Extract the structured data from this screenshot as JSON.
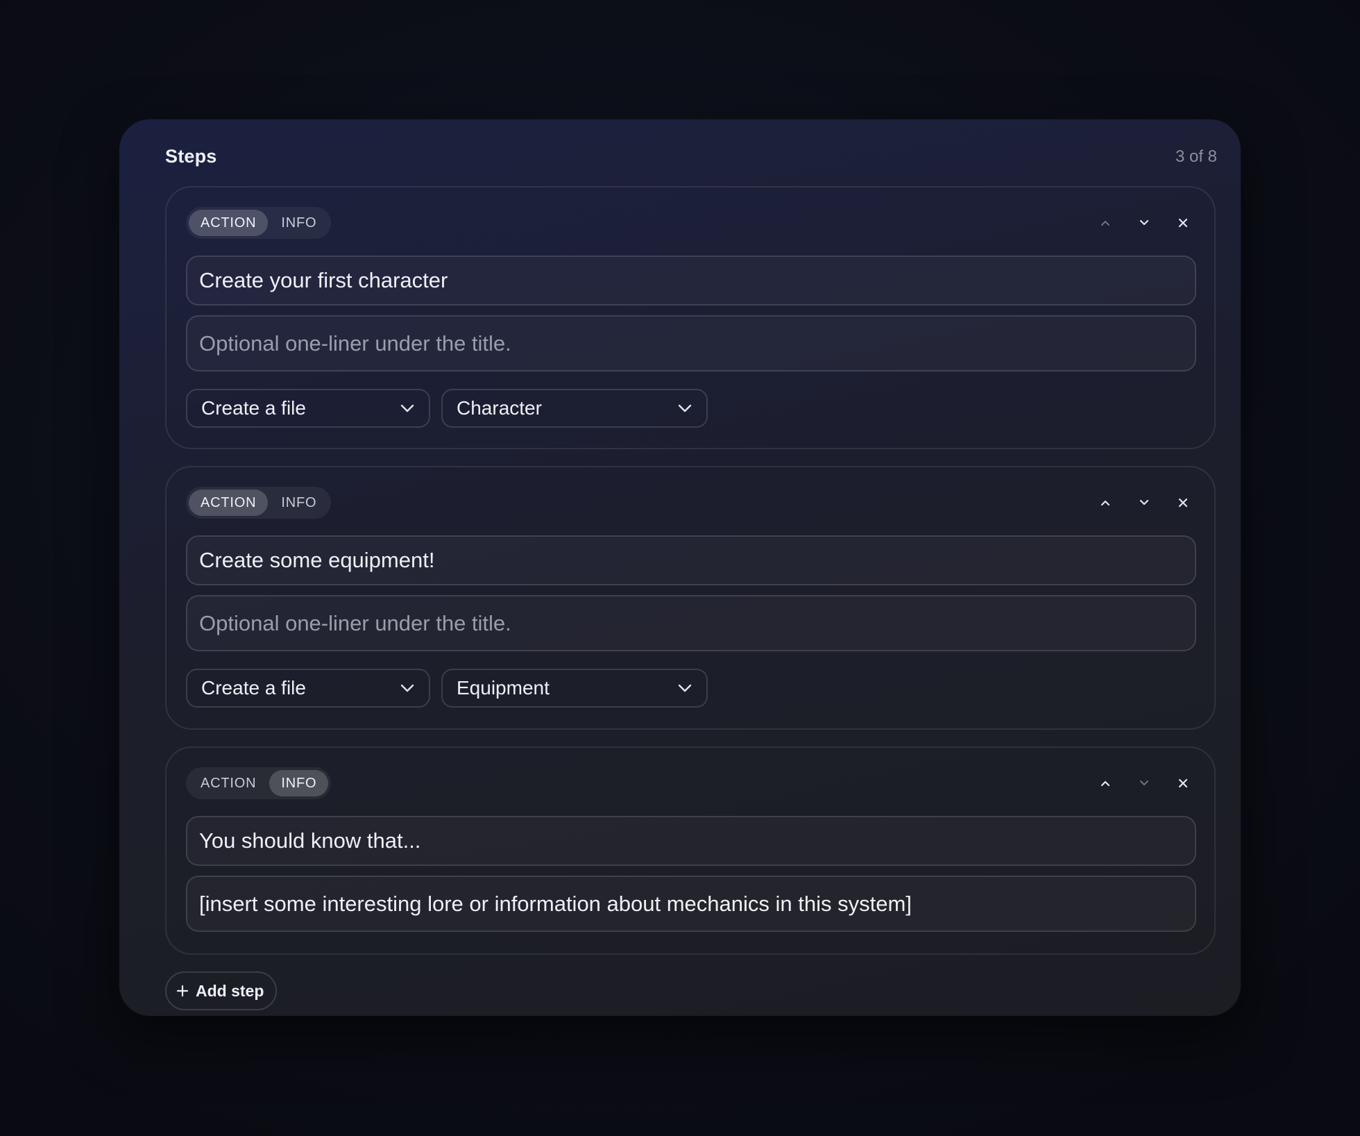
{
  "panel": {
    "title": "Steps",
    "count": "3 of 8"
  },
  "steps": [
    {
      "type_options": [
        "ACTION",
        "INFO"
      ],
      "active_type": "ACTION",
      "title": "Create your first character",
      "subtitle_placeholder": "Optional one-liner under the title.",
      "action_select": "Create a file",
      "target_select": "Character"
    },
    {
      "type_options": [
        "ACTION",
        "INFO"
      ],
      "active_type": "ACTION",
      "title": "Create some equipment!",
      "subtitle_placeholder": "Optional one-liner under the title.",
      "action_select": "Create a file",
      "target_select": "Equipment"
    },
    {
      "type_options": [
        "ACTION",
        "INFO"
      ],
      "active_type": "INFO",
      "title": "You should know that...",
      "body": "[insert some interesting lore or information about mechanics in this system]"
    }
  ],
  "add_step_label": "Add step",
  "icons": {
    "move_up": "chevron-up-icon",
    "move_down": "chevron-down-icon",
    "remove": "close-icon",
    "dropdown": "chevron-down-icon",
    "add": "plus-icon"
  }
}
